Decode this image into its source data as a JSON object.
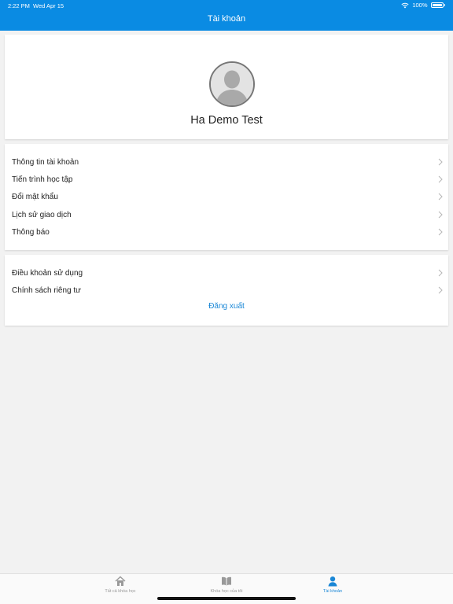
{
  "status_bar": {
    "time": "2:22 PM",
    "date": "Wed Apr 15",
    "battery": "100%"
  },
  "header": {
    "title": "Tài khoản"
  },
  "profile": {
    "name": "Ha Demo Test",
    "avatar_icon": "default-user-avatar"
  },
  "menu_section_1": {
    "items": [
      {
        "label": "Thông tin tài khoản"
      },
      {
        "label": "Tiến trình học tập"
      },
      {
        "label": "Đổi mật khẩu"
      },
      {
        "label": "Lịch sử giao dịch"
      },
      {
        "label": "Thông báo"
      }
    ]
  },
  "menu_section_2": {
    "items": [
      {
        "label": "Điều khoản sử dụng"
      },
      {
        "label": "Chính sách riêng tư"
      }
    ],
    "logout_label": "Đăng xuất"
  },
  "tab_bar": {
    "tabs": [
      {
        "label": "Tất cả khóa học",
        "icon": "home-icon"
      },
      {
        "label": "Khóa học của tôi",
        "icon": "book-icon"
      },
      {
        "label": "Tài khoản",
        "icon": "person-icon"
      }
    ],
    "active_index": 2
  },
  "colors": {
    "accent": "#0a8be3",
    "link": "#1a87d6",
    "background": "#f2f2f2"
  }
}
